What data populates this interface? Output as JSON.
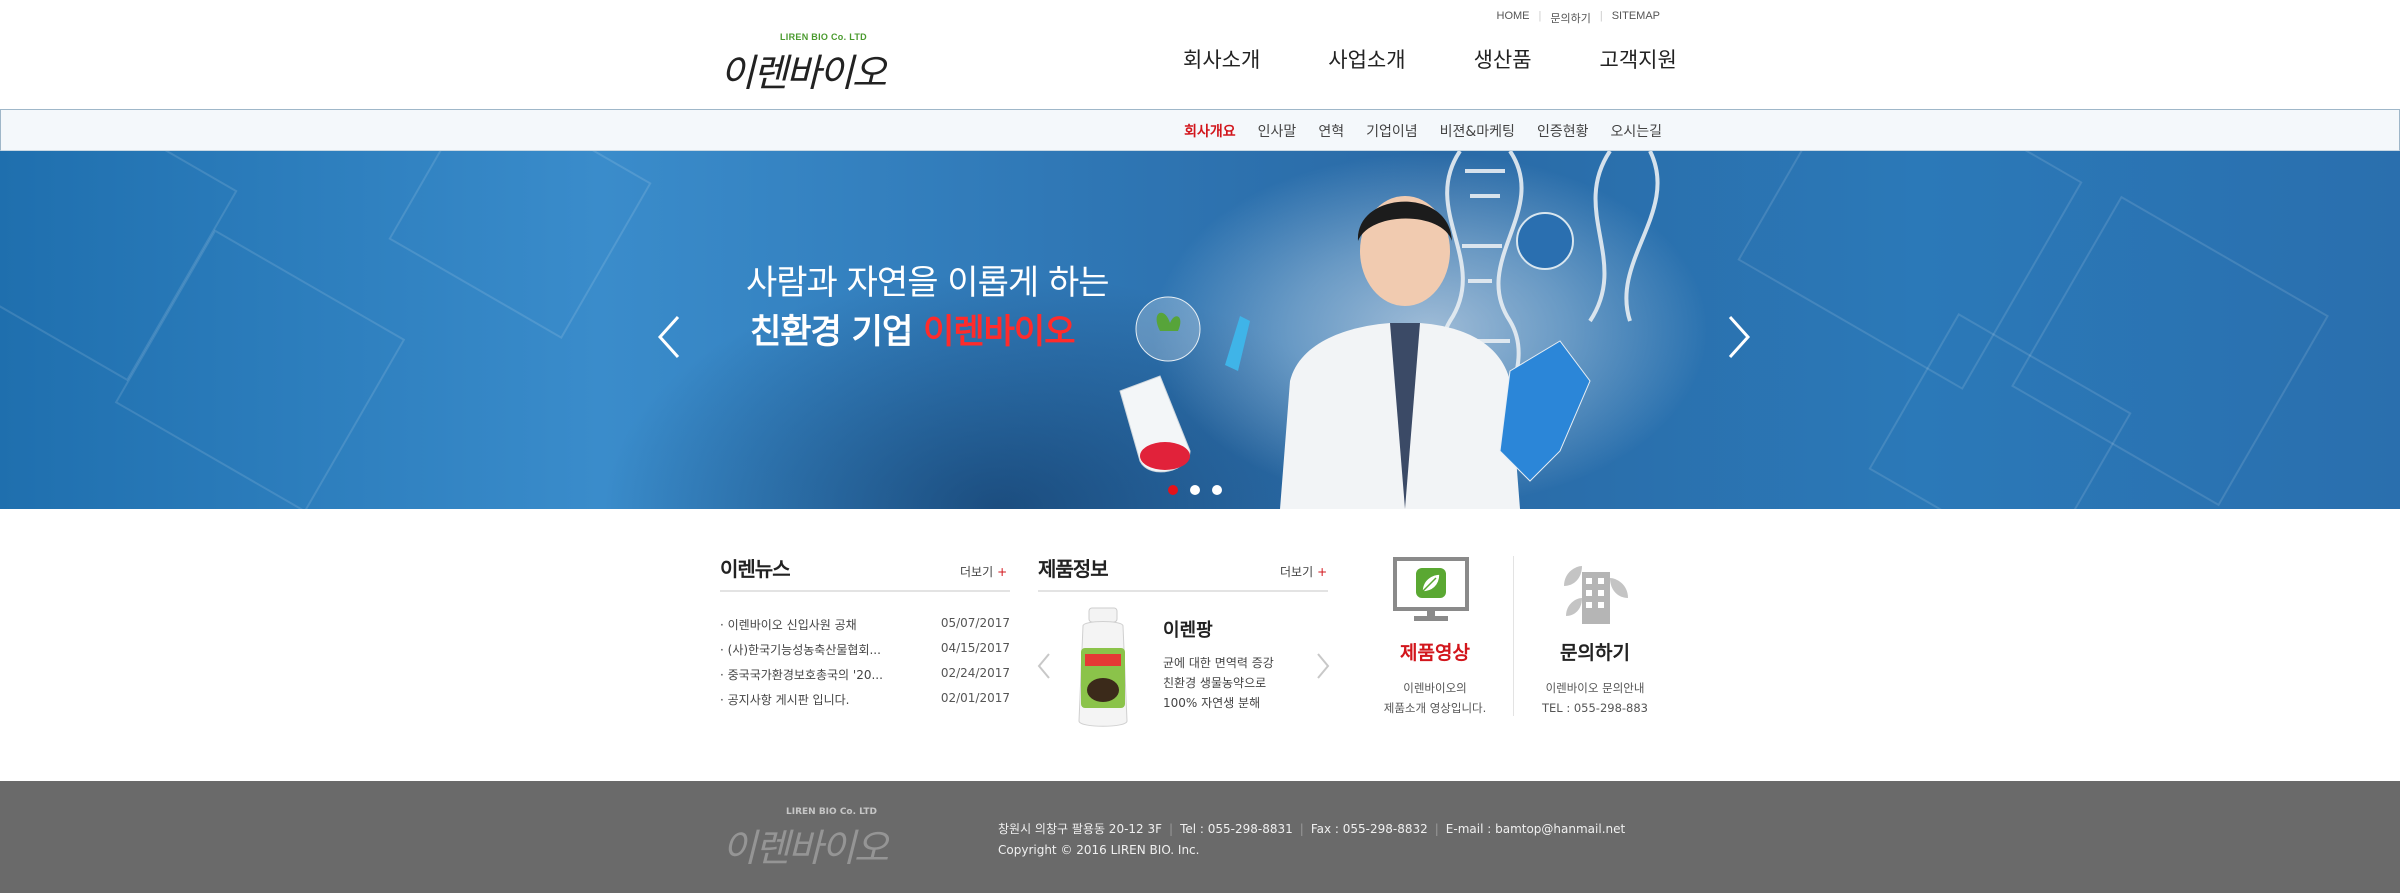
{
  "logo": {
    "en": "LIREN BIO Co. LTD",
    "kr": "이렌바이오"
  },
  "util_links": [
    "HOME",
    "문의하기",
    "SITEMAP"
  ],
  "gnb": [
    "회사소개",
    "사업소개",
    "생산품",
    "고객지원"
  ],
  "subnav": {
    "active": "회사개요",
    "items": [
      "인사말",
      "연혁",
      "기업이념",
      "비젼&마케팅",
      "인증현황",
      "오시는길"
    ]
  },
  "banner": {
    "line1": "사람과 자연을 이롭게 하는",
    "line2_prefix": "친환경 기업 ",
    "line2_highlight": "이렌바이오",
    "slide_count": 3,
    "active_slide": 1
  },
  "news": {
    "title": "이렌뉴스",
    "more": "더보기",
    "items": [
      {
        "title": "이렌바이오 신입사원 공채",
        "date": "05/07/2017"
      },
      {
        "title": "(사)한국기능성농축산물협회...",
        "date": "04/15/2017"
      },
      {
        "title": "중국국가환경보호총국의 '20...",
        "date": "02/24/2017"
      },
      {
        "title": "공지사항 게시판 입니다.",
        "date": "02/01/2017"
      }
    ]
  },
  "product": {
    "title": "제품정보",
    "more": "더보기",
    "name": "이렌팡",
    "desc": [
      "균에 대한 면역력 증강",
      "친환경 생물농약으로",
      "100% 자연생 분해"
    ]
  },
  "video": {
    "title": "제품영상",
    "desc": [
      "이렌바이오의",
      "제품소개 영상입니다."
    ]
  },
  "inquiry": {
    "title": "문의하기",
    "desc": [
      "이렌바이오 문의안내",
      "TEL : 055-298-883"
    ]
  },
  "footer": {
    "logo_en": "LIREN BIO Co. LTD",
    "logo_kr": "이렌바이오",
    "address": "창원시 의창구 팔용동 20-12 3F",
    "tel": "Tel : 055-298-8831",
    "fax": "Fax : 055-298-8832",
    "email": "E-mail : bamtop@hanmail.net",
    "copyright": "Copyright © 2016 LIREN BIO. Inc."
  },
  "colors": {
    "accent_red": "#d2161c",
    "banner_blue": "#2f77b5",
    "footer_gray": "#6a6a6a",
    "green": "#4aa12a"
  }
}
